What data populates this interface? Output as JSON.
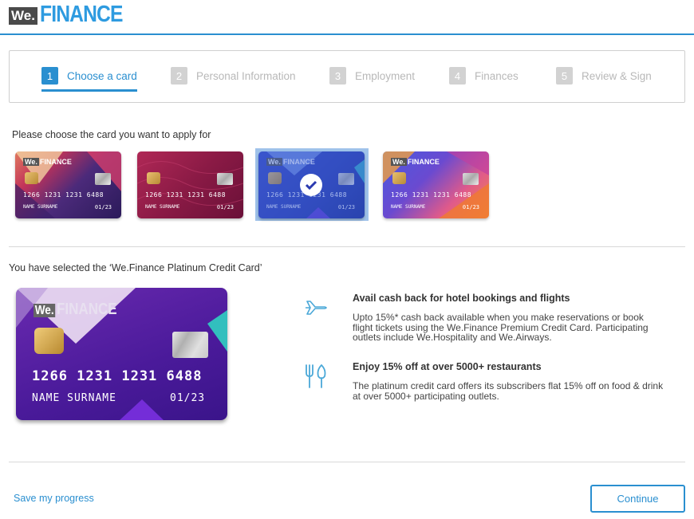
{
  "brand": {
    "prefix": "We.",
    "name": "FINANCE"
  },
  "stepper": {
    "steps": [
      {
        "num": "1",
        "label": "Choose a card"
      },
      {
        "num": "2",
        "label": "Personal Information"
      },
      {
        "num": "3",
        "label": "Employment"
      },
      {
        "num": "4",
        "label": "Finances"
      },
      {
        "num": "5",
        "label": "Review & Sign"
      }
    ],
    "active_step": 1
  },
  "card_picker": {
    "prompt": "Please choose the card you want to apply for",
    "cards": [
      {
        "logo_prefix": "We.",
        "logo_name": "FINANCE",
        "number": "1266 1231 1231 6488",
        "name": "NAME SURNAME",
        "expiry": "01/23",
        "selected": false
      },
      {
        "logo_prefix": "",
        "logo_name": "",
        "number": "1266 1231 1231 6488",
        "name": "NAME SURNAME",
        "expiry": "01/23",
        "selected": false
      },
      {
        "logo_prefix": "We.",
        "logo_name": "FINANCE",
        "number": "1266 1231 1231 6488",
        "name": "NAME SURNAME",
        "expiry": "01/23",
        "selected": true
      },
      {
        "logo_prefix": "We.",
        "logo_name": "FINANCE",
        "number": "1266 1231 1231 6488",
        "name": "NAME SURNAME",
        "expiry": "01/23",
        "selected": false
      }
    ]
  },
  "selection": {
    "text": "You have selected the ‘We.Finance Platinum Credit Card’",
    "card": {
      "logo_prefix": "We.",
      "logo_name": "FINANCE",
      "number": "1266 1231 1231 6488",
      "name": "NAME SURNAME",
      "expiry": "01/23"
    }
  },
  "features": [
    {
      "icon": "airplane-icon",
      "title": "Avail cash back for hotel bookings and flights",
      "desc": "Upto 15%* cash back available when you make reservations or book flight tickets using the We.Finance Premium Credit Card. Participating outlets include We.Hospitality and We.Airways."
    },
    {
      "icon": "cutlery-icon",
      "title": "Enjoy 15% off at over 5000+ restaurants",
      "desc": "The platinum credit card offers its subscribers flat 15% off on food & drink at over 5000+ participating outlets."
    }
  ],
  "footer": {
    "save_label": "Save my progress",
    "continue_label": "Continue"
  },
  "colors": {
    "accent": "#2a8fd0",
    "inactive": "#b8b8b8"
  }
}
